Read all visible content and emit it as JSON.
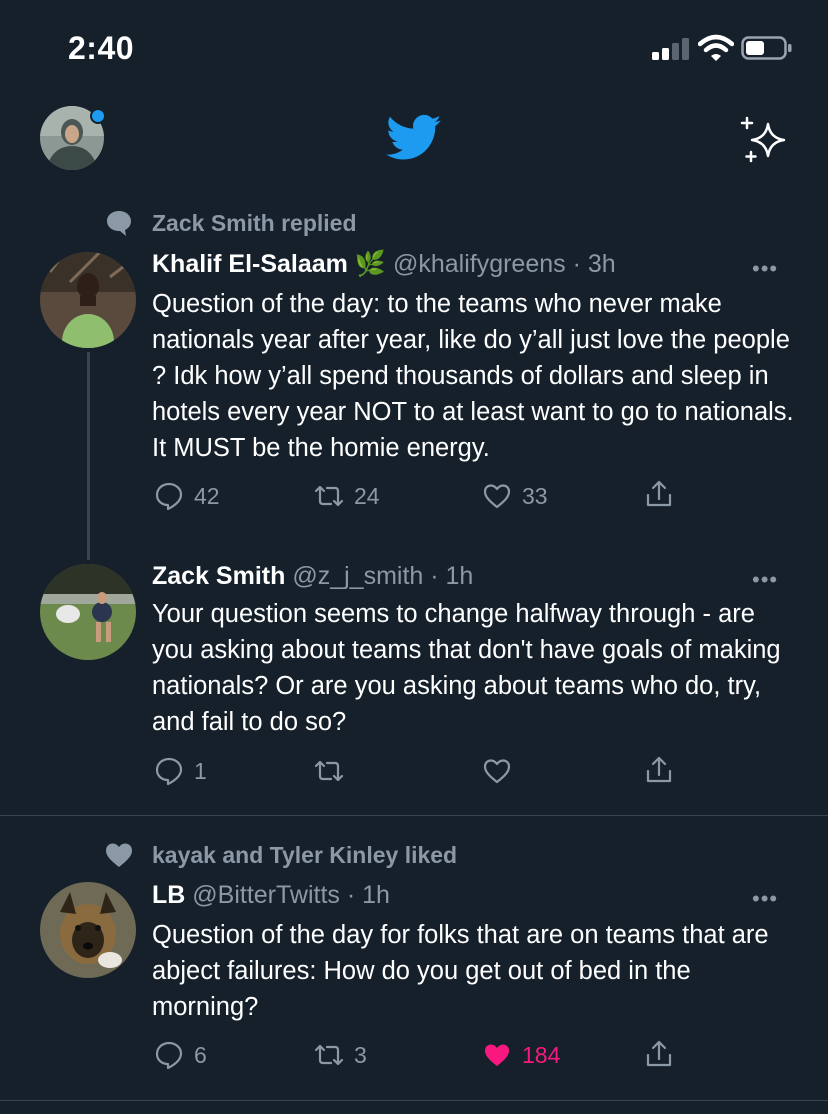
{
  "status_bar": {
    "time": "2:40"
  },
  "header": {
    "logo": "twitter-bird-icon",
    "action_icon": "sparkle-icon",
    "avatar_badge": "blue-dot"
  },
  "colors": {
    "background": "#15202b",
    "accent": "#1d9bf0",
    "muted": "#8b98a5",
    "like": "#f91880"
  },
  "tweets": [
    {
      "context": "Zack Smith replied",
      "context_icon": "speech-bubble-icon",
      "name": "Khalif El-Salaam",
      "name_emoji": "🌿",
      "handle_time": "@khalifygreens · 3h",
      "more": "•••",
      "text": "Question of the day: to the teams who never make nationals year after year, like do y’all just love the people ? Idk how y’all spend thousands of dollars and sleep in hotels every year NOT to at least want to go to nationals. It MUST be the homie energy.",
      "replies": "42",
      "retweets": "24",
      "likes": "33"
    },
    {
      "name": "Zack Smith",
      "handle_time": "@z_j_smith · 1h",
      "more": "•••",
      "text": "Your question seems to change halfway through - are you asking about teams that don't have goals of making nationals? Or are you asking about teams who do, try, and fail to do so?",
      "replies": "1",
      "retweets": "",
      "likes": ""
    },
    {
      "context": "kayak and Tyler Kinley liked",
      "context_icon": "heart-icon",
      "name": "LB",
      "handle_time": "@BitterTwitts · 1h",
      "more": "•••",
      "text": "Question of the day for folks that are on teams that are abject failures: How do you get out of bed in the morning?",
      "replies": "6",
      "retweets": "3",
      "likes": "184",
      "liked": true
    }
  ]
}
